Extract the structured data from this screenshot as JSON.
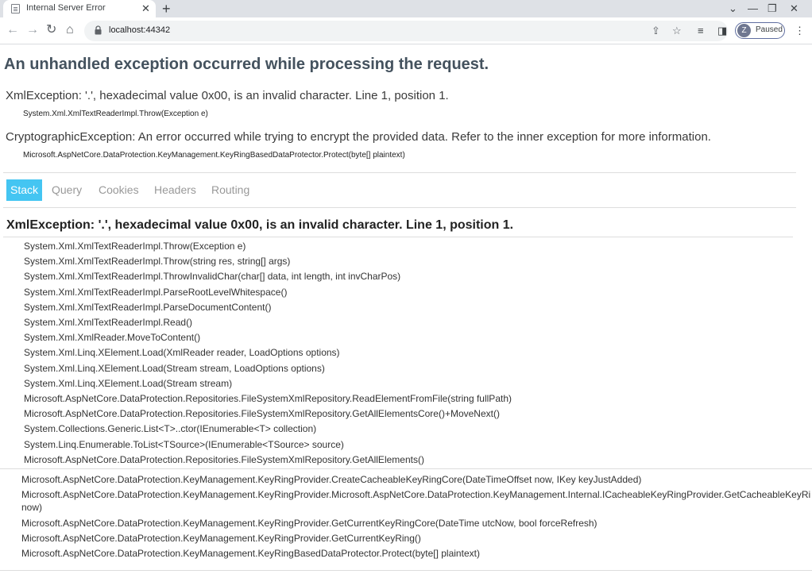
{
  "browser": {
    "tab_title": "Internal Server Error",
    "tab_close": "✕",
    "new_tab": "+",
    "url": "localhost:44342",
    "profile_initial": "Z",
    "profile_status": "Paused"
  },
  "page": {
    "title": "An unhandled exception occurred while processing the request.",
    "summary": [
      {
        "message": "XmlException: '.', hexadecimal value 0x00, is an invalid character. Line 1, position 1.",
        "location": "System.Xml.XmlTextReaderImpl.Throw(Exception e)"
      },
      {
        "message": "CryptographicException: An error occurred while trying to encrypt the provided data. Refer to the inner exception for more information.",
        "location": "Microsoft.AspNetCore.DataProtection.KeyManagement.KeyRingBasedDataProtector.Protect(byte[] plaintext)"
      }
    ],
    "tabs": [
      "Stack",
      "Query",
      "Cookies",
      "Headers",
      "Routing"
    ],
    "stack_title": "XmlException: '.', hexadecimal value 0x00, is an invalid character. Line 1, position 1.",
    "frames": [
      "System.Xml.XmlTextReaderImpl.Throw(Exception e)",
      "System.Xml.XmlTextReaderImpl.Throw(string res, string[] args)",
      "System.Xml.XmlTextReaderImpl.ThrowInvalidChar(char[] data, int length, int invCharPos)",
      "System.Xml.XmlTextReaderImpl.ParseRootLevelWhitespace()",
      "System.Xml.XmlTextReaderImpl.ParseDocumentContent()",
      "System.Xml.XmlTextReaderImpl.Read()",
      "System.Xml.XmlReader.MoveToContent()",
      "System.Xml.Linq.XElement.Load(XmlReader reader, LoadOptions options)",
      "System.Xml.Linq.XElement.Load(Stream stream, LoadOptions options)",
      "System.Xml.Linq.XElement.Load(Stream stream)",
      "Microsoft.AspNetCore.DataProtection.Repositories.FileSystemXmlRepository.ReadElementFromFile(string fullPath)",
      "Microsoft.AspNetCore.DataProtection.Repositories.FileSystemXmlRepository.GetAllElementsCore()+MoveNext()",
      "System.Collections.Generic.List<T>..ctor(IEnumerable<T> collection)",
      "System.Linq.Enumerable.ToList<TSource>(IEnumerable<TSource> source)",
      "Microsoft.AspNetCore.DataProtection.Repositories.FileSystemXmlRepository.GetAllElements()"
    ],
    "frames2": [
      "Microsoft.AspNetCore.DataProtection.KeyManagement.KeyRingProvider.CreateCacheableKeyRingCore(DateTimeOffset now, IKey keyJustAdded)",
      "Microsoft.AspNetCore.DataProtection.KeyManagement.KeyRingProvider.Microsoft.AspNetCore.DataProtection.KeyManagement.Internal.ICacheableKeyRingProvider.GetCacheableKeyRi",
      "now)",
      "Microsoft.AspNetCore.DataProtection.KeyManagement.KeyRingProvider.GetCurrentKeyRingCore(DateTime utcNow, bool forceRefresh)",
      "Microsoft.AspNetCore.DataProtection.KeyManagement.KeyRingProvider.GetCurrentKeyRing()",
      "Microsoft.AspNetCore.DataProtection.KeyManagement.KeyRingBasedDataProtector.Protect(byte[] plaintext)"
    ]
  }
}
